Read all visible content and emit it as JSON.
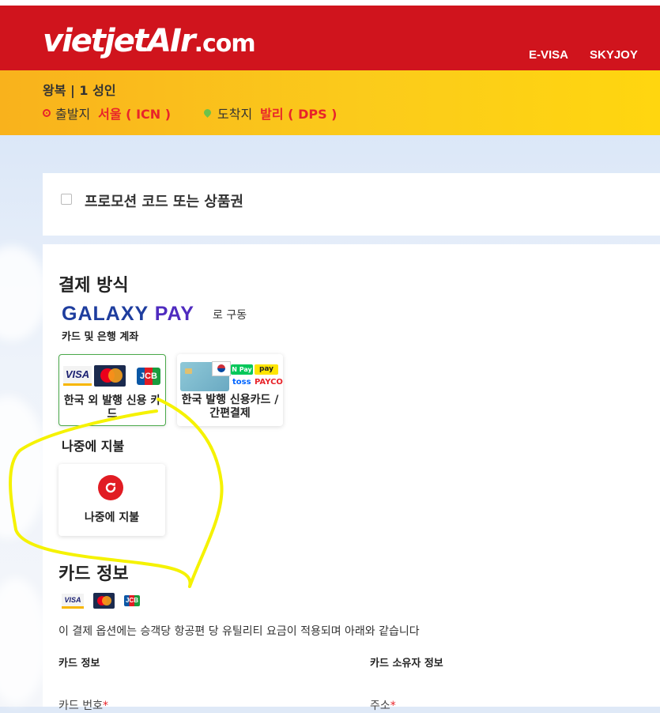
{
  "header": {
    "logo_main": "vietjetAIr",
    "logo_suffix": ".com",
    "nav": [
      "E-VISA",
      "SKYJOY"
    ]
  },
  "trip": {
    "type": "왕복 | 1 성인",
    "origin_label": "출발지",
    "origin_city": "서울 ( ICN )",
    "destination_label": "도착지",
    "destination_city": "발리 ( DPS )"
  },
  "promo": {
    "label": "프로모션 코드 또는 상품권",
    "checked": false
  },
  "payment": {
    "title": "결제 방식",
    "provider_a": "GALAXY",
    "provider_b": "PAY",
    "provider_suffix": "로 구동",
    "section_cards_label": "카드 및 은행 계좌",
    "options": [
      {
        "label": "한국 외 발행 신용 카드",
        "selected": true
      },
      {
        "label": "한국 발행 신용카드 / 간편결제",
        "selected": false
      }
    ],
    "korean_logos": {
      "npay": "N Pay",
      "kakaopay": "pay",
      "toss": "toss",
      "payco": "PAYCO"
    },
    "section_later_label": "나중에 지불",
    "later_option": {
      "label": "나중에 지불"
    }
  },
  "card_info": {
    "title": "카드 정보",
    "brand_visa": "VISA",
    "brand_mc": "MasterCard",
    "brand_jcb": "JCB",
    "note": "이 결제 옵션에는 승객당 항공편 당 유틸리티 요금이 적용되며 아래와 같습니다",
    "col_card": "카드 정보",
    "col_holder": "카드 소유자 정보",
    "field_card_number": "카드 번호",
    "field_address": "주소"
  },
  "colors": {
    "brand_red": "#d0141d",
    "yellow": "#fbcb1b",
    "highlight": "#f5f200",
    "selected_border": "#4aa94a"
  }
}
